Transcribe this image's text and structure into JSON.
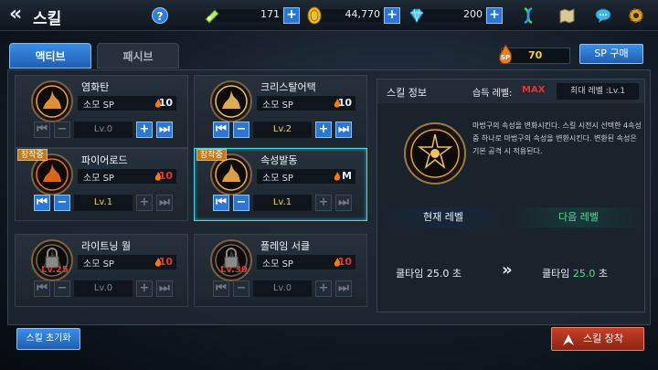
{
  "header": {
    "title": "스킬",
    "help": "?",
    "resources": [
      {
        "icon": "ticket-icon",
        "value": "171"
      },
      {
        "icon": "gold-coin-icon",
        "value": "44,770"
      },
      {
        "icon": "diamond-gem-icon",
        "value": "200"
      }
    ],
    "plus": "+"
  },
  "tabs": {
    "active": "액티브",
    "passive": "패시브"
  },
  "sp": {
    "value": "70",
    "icon_text": "SP",
    "buy_label": "SP 구매"
  },
  "skills": [
    {
      "name": "염화탄",
      "sp_label": "소모 SP",
      "cost": "10",
      "cost_color": "#e8eef4",
      "level": "Lv.0",
      "equipped": "",
      "locked": "",
      "minus": "−",
      "plus": "+"
    },
    {
      "name": "크리스탈어택",
      "sp_label": "소모 SP",
      "cost": "10",
      "cost_color": "#e8eef4",
      "level": "Lv.2",
      "equipped": "",
      "locked": "",
      "minus": "−",
      "plus": "+"
    },
    {
      "name": "파이어로드",
      "sp_label": "소모 SP",
      "cost": "10",
      "cost_color": "#e23434",
      "level": "Lv.1",
      "equipped": "장착중",
      "locked": "",
      "minus": "−",
      "plus": "+"
    },
    {
      "name": "속성발동",
      "sp_label": "소모 SP",
      "cost": "M",
      "cost_color": "#e8eef4",
      "level": "Lv.1",
      "equipped": "장착중",
      "locked": "",
      "minus": "−",
      "plus": "+"
    },
    {
      "name": "라이트닝 월",
      "sp_label": "소모 SP",
      "cost": "10",
      "cost_color": "#e23434",
      "level": "Lv.0",
      "equipped": "",
      "locked": "Lv.25",
      "minus": "−",
      "plus": "+"
    },
    {
      "name": "플레임 서클",
      "sp_label": "소모 SP",
      "cost": "10",
      "cost_color": "#e23434",
      "level": "Lv.0",
      "equipped": "",
      "locked": "Lv.30",
      "minus": "−",
      "plus": "+"
    }
  ],
  "info": {
    "title": "스킬 정보",
    "learn_label": "습득 레벨:",
    "learn_value": "MAX",
    "max_level": "최대 레벨 :Lv.1",
    "description": "마법구의 속성을 변화시킨다. 스킬 시전시 선택한 4속성중 하나로 마법구의 속성을 변환시킨다. 변환된 속성은 기본 공격 시 적용된다.",
    "current_label": "현재 레벨",
    "next_label": "다음 레벨",
    "cd_label": "쿨타임",
    "current_cd": "25.0",
    "next_cd": "25.0",
    "cd_unit": "초",
    "arrow": "»"
  },
  "buttons": {
    "reset": "스킬 초기화",
    "equip": "스킬 장착"
  }
}
